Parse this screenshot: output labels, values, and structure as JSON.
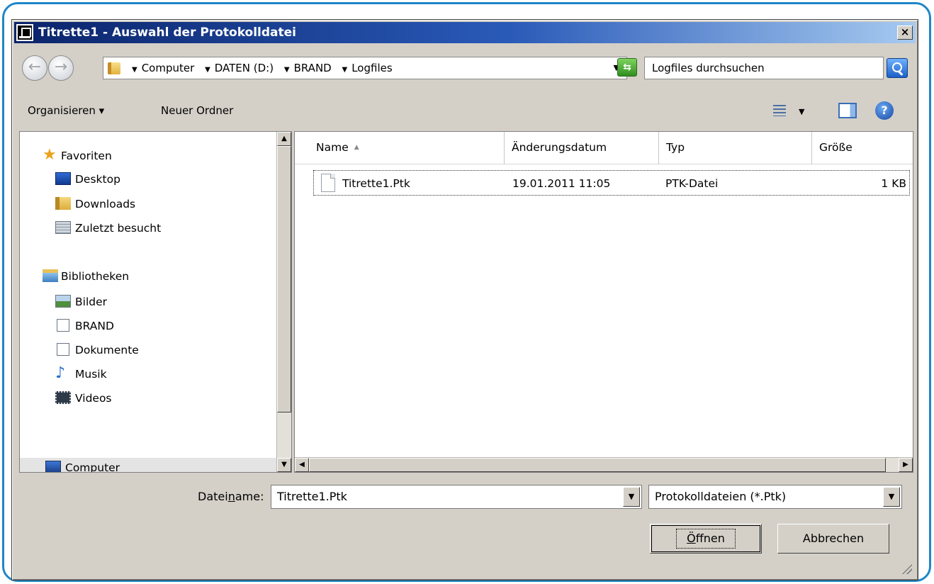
{
  "window": {
    "title": "Titrette1 - Auswahl der Protokolldatei",
    "close_label": "×"
  },
  "nav": {
    "back_label": "←",
    "forward_label": "→",
    "breadcrumbs": [
      "Computer",
      "DATEN (D:)",
      "BRAND",
      "Logfiles"
    ],
    "search_placeholder": "Logfiles durchsuchen"
  },
  "toolbar": {
    "organize_label": "Organisieren ▾",
    "new_folder_label": "Neuer Ordner",
    "help_label": "?"
  },
  "sidebar": {
    "items": [
      {
        "label": "Favoriten",
        "icon": "star-icon"
      },
      {
        "label": "Desktop",
        "icon": "desktop-icon"
      },
      {
        "label": "Downloads",
        "icon": "downloads-folder-icon"
      },
      {
        "label": "Zuletzt besucht",
        "icon": "recent-places-icon"
      },
      {
        "label": "Bibliotheken",
        "icon": "libraries-icon"
      },
      {
        "label": "Bilder",
        "icon": "pictures-icon"
      },
      {
        "label": "BRAND",
        "icon": "library-doc-icon"
      },
      {
        "label": "Dokumente",
        "icon": "documents-icon"
      },
      {
        "label": "Musik",
        "icon": "music-note-icon"
      },
      {
        "label": "Videos",
        "icon": "film-icon"
      },
      {
        "label": "Computer",
        "icon": "computer-icon",
        "selected": true
      }
    ]
  },
  "file_list": {
    "columns": [
      "Name",
      "Änderungsdatum",
      "Typ",
      "Größe"
    ],
    "sorted_column": "Name",
    "rows": [
      {
        "name": "Titrette1.Ptk",
        "modified": "19.01.2011 11:05",
        "type": "PTK-Datei",
        "size": "1 KB"
      }
    ]
  },
  "filename": {
    "label_prefix": "Datei",
    "label_accel": "n",
    "label_suffix": "ame:",
    "value": "Titrette1.Ptk"
  },
  "filetype": {
    "selected": "Protokolldateien (*.Ptk)"
  },
  "buttons": {
    "open_accel": "Ö",
    "open_rest": "ffnen",
    "cancel_label": "Abbrechen"
  }
}
